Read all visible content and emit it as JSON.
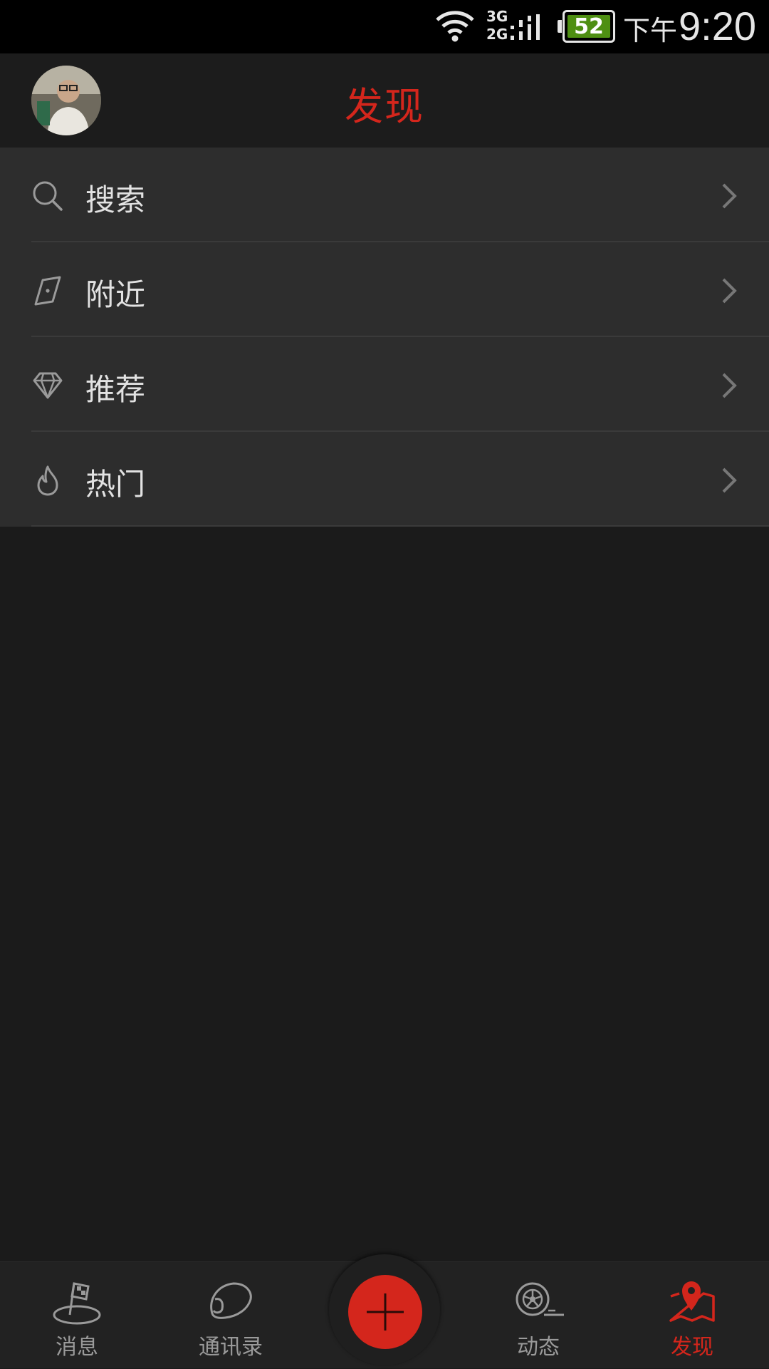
{
  "status_bar": {
    "network_top": "3G",
    "network_bottom": "2G",
    "battery_level": "52",
    "battery_color": "#4e8f12",
    "ampm": "下午",
    "time": "9:20"
  },
  "header": {
    "title": "发现",
    "accent_color": "#d4261c"
  },
  "menu": {
    "items": [
      {
        "label": "搜索",
        "icon": "search-icon"
      },
      {
        "label": "附近",
        "icon": "compass-icon"
      },
      {
        "label": "推荐",
        "icon": "diamond-icon"
      },
      {
        "label": "热门",
        "icon": "flame-icon"
      }
    ]
  },
  "tabs": [
    {
      "label": "消息",
      "icon": "flag-icon",
      "active": false
    },
    {
      "label": "通讯录",
      "icon": "helmet-icon",
      "active": false
    },
    {
      "label": "",
      "icon": "plus-icon",
      "active": false
    },
    {
      "label": "动态",
      "icon": "wheel-icon",
      "active": false
    },
    {
      "label": "发现",
      "icon": "map-pin-icon",
      "active": true
    }
  ]
}
